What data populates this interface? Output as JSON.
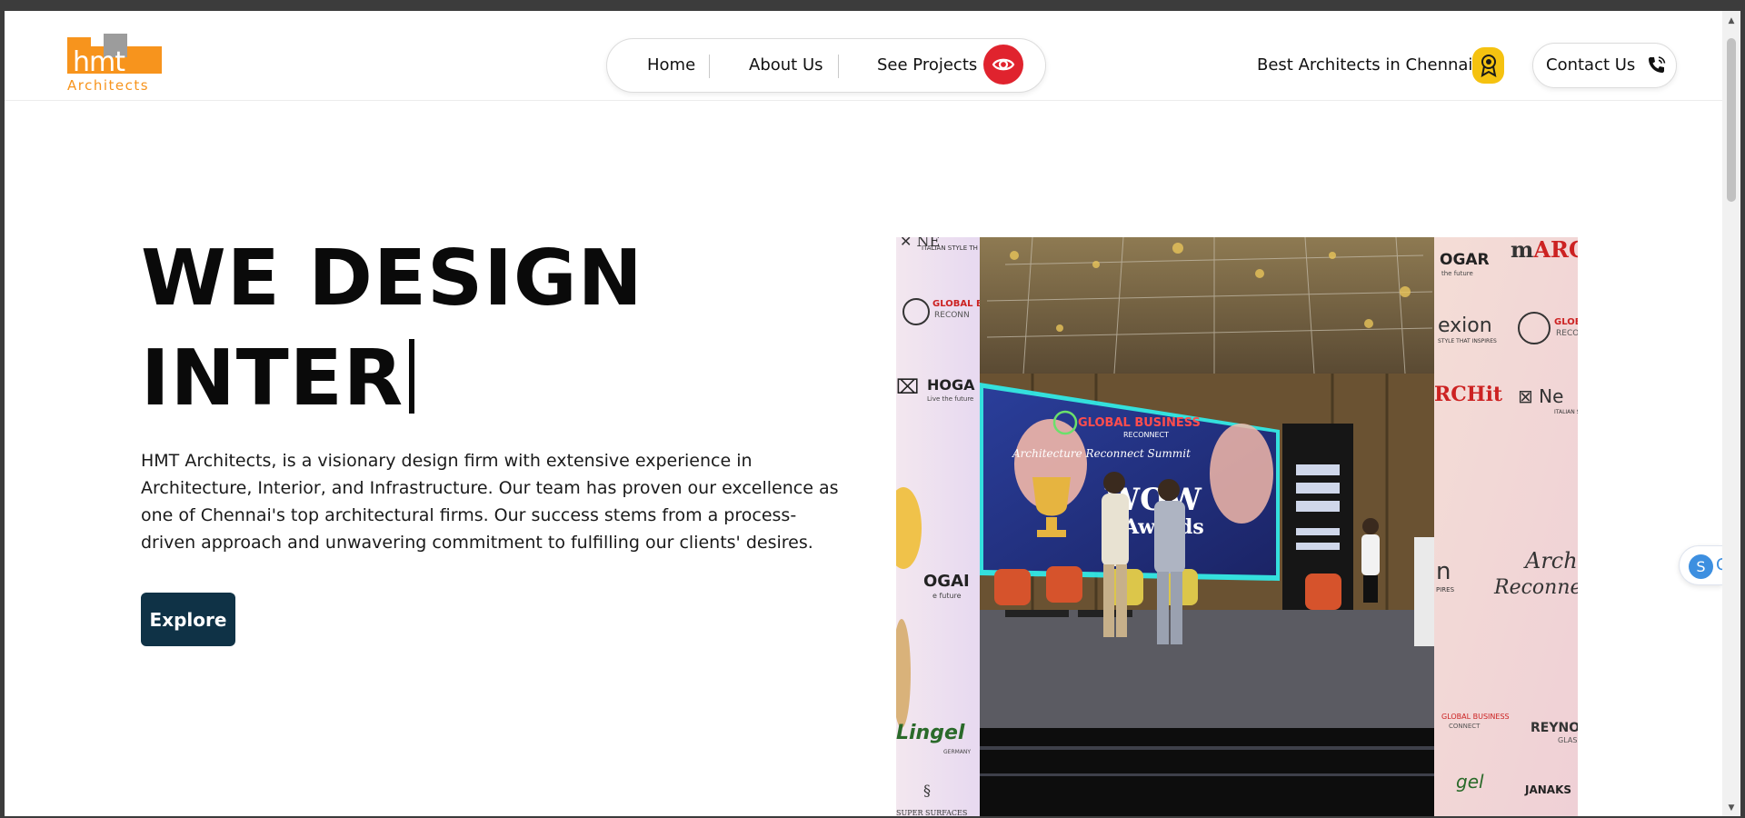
{
  "header": {
    "logo_text": "hmt",
    "logo_subtext": "Architects",
    "nav": [
      {
        "label": "Home"
      },
      {
        "label": "About Us"
      },
      {
        "label": "See Projects"
      }
    ],
    "best_text": "Best Architects in Chennai",
    "contact_label": "Contact Us"
  },
  "hero": {
    "headline_line1": "WE DESIGN",
    "headline_line2": "INTER",
    "description": "HMT Architects, is a visionary design firm with extensive experience in Architecture, Interior, and Infrastructure. Our team has proven our excellence as one of Chennai's top architectural firms. Our success stems from a process-driven approach and unwavering commitment to fulfilling our clients' desires.",
    "explore_label": "Explore"
  },
  "photo": {
    "banner_title": "GLOBAL BUSINESS",
    "banner_subtitle": "RECONNECT",
    "summit_text": "Architecture Reconnect Summit",
    "award_text": "WOW Awards",
    "backdrop_brands": [
      "NEXION",
      "ITALIAN STYLE THAT INSPIRES",
      "GLOBAL BUSINESS",
      "RECONNECT",
      "HOGAR",
      "Live the future",
      "mARC",
      "ARCHit",
      "exion",
      "Archi",
      "Reconne",
      "Lingel",
      "GERMANY",
      "REYNO",
      "GLASS",
      "JANAKS",
      "SUPER SURFACES",
      "PIRES"
    ]
  },
  "side_widget": {
    "letter": "S",
    "tail": "C"
  },
  "colors": {
    "logo_orange": "#f7941d",
    "logo_grey": "#8c8c8c",
    "eye_red": "#e0232e",
    "badge_yellow": "#f5c210",
    "explore_bg": "#0f3246"
  }
}
